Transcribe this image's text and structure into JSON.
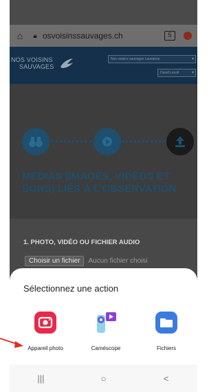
{
  "browser": {
    "url": "osvoisinssauvages.ch",
    "tab_count": "5"
  },
  "site": {
    "logo_line1": "NOS VOISINS",
    "logo_line2": "SAUVAGES",
    "location_field": "Nos voisins sauvages Lausanne",
    "user_field": "David Lecoit"
  },
  "page": {
    "title": "MÉDIAS (IMAGES, VIDÉOS ET SONS) LIÉS À L’OBSERVATION",
    "field_label": "1. PHOTO, VIDÉO OU FICHIER AUDIO",
    "file_button": "Choisir un fichier",
    "file_status": "Aucun fichier choisi"
  },
  "sheet": {
    "title": "Sélectionnez une action",
    "apps": [
      {
        "label": "Appareil photo",
        "icon": "camera-icon"
      },
      {
        "label": "Caméscope",
        "icon": "camcorder-icon"
      },
      {
        "label": "Fichiers",
        "icon": "folder-icon"
      }
    ]
  },
  "navbar": {
    "recents": "|||",
    "home": "○",
    "back": "<"
  },
  "colors": {
    "accent": "#1e4f6e",
    "header": "#14304a",
    "camera": "#e8294a",
    "folder": "#3b7be0",
    "arrow": "#e03020"
  }
}
